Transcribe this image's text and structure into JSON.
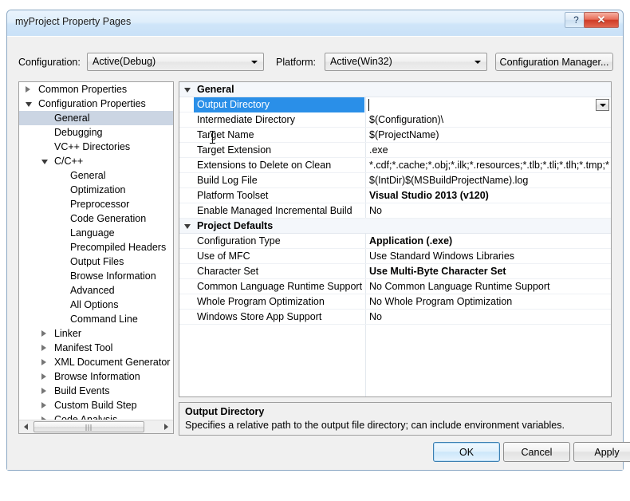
{
  "window": {
    "title": "myProject Property Pages",
    "help_button": "?",
    "close_button": "✕"
  },
  "toolbar": {
    "configuration_label": "Configuration:",
    "configuration_value": "Active(Debug)",
    "platform_label": "Platform:",
    "platform_value": "Active(Win32)",
    "configuration_manager_button": "Configuration Manager..."
  },
  "tree": {
    "items": [
      {
        "label": "Common Properties",
        "indent": 0,
        "twisty": "collapsed",
        "selected": false
      },
      {
        "label": "Configuration Properties",
        "indent": 0,
        "twisty": "expanded",
        "selected": false
      },
      {
        "label": "General",
        "indent": 1,
        "twisty": "none",
        "selected": true
      },
      {
        "label": "Debugging",
        "indent": 1,
        "twisty": "none",
        "selected": false
      },
      {
        "label": "VC++ Directories",
        "indent": 1,
        "twisty": "none",
        "selected": false
      },
      {
        "label": "C/C++",
        "indent": 1,
        "twisty": "expanded",
        "selected": false
      },
      {
        "label": "General",
        "indent": 2,
        "twisty": "none",
        "selected": false
      },
      {
        "label": "Optimization",
        "indent": 2,
        "twisty": "none",
        "selected": false
      },
      {
        "label": "Preprocessor",
        "indent": 2,
        "twisty": "none",
        "selected": false
      },
      {
        "label": "Code Generation",
        "indent": 2,
        "twisty": "none",
        "selected": false
      },
      {
        "label": "Language",
        "indent": 2,
        "twisty": "none",
        "selected": false
      },
      {
        "label": "Precompiled Headers",
        "indent": 2,
        "twisty": "none",
        "selected": false
      },
      {
        "label": "Output Files",
        "indent": 2,
        "twisty": "none",
        "selected": false
      },
      {
        "label": "Browse Information",
        "indent": 2,
        "twisty": "none",
        "selected": false
      },
      {
        "label": "Advanced",
        "indent": 2,
        "twisty": "none",
        "selected": false
      },
      {
        "label": "All Options",
        "indent": 2,
        "twisty": "none",
        "selected": false
      },
      {
        "label": "Command Line",
        "indent": 2,
        "twisty": "none",
        "selected": false
      },
      {
        "label": "Linker",
        "indent": 1,
        "twisty": "collapsed",
        "selected": false
      },
      {
        "label": "Manifest Tool",
        "indent": 1,
        "twisty": "collapsed",
        "selected": false
      },
      {
        "label": "XML Document Generator",
        "indent": 1,
        "twisty": "collapsed",
        "selected": false
      },
      {
        "label": "Browse Information",
        "indent": 1,
        "twisty": "collapsed",
        "selected": false
      },
      {
        "label": "Build Events",
        "indent": 1,
        "twisty": "collapsed",
        "selected": false
      },
      {
        "label": "Custom Build Step",
        "indent": 1,
        "twisty": "collapsed",
        "selected": false
      },
      {
        "label": "Code Analysis",
        "indent": 1,
        "twisty": "collapsed",
        "selected": false
      }
    ]
  },
  "grid": {
    "categories": [
      {
        "name": "General",
        "rows": [
          {
            "label": "Output Directory",
            "value": "",
            "bold": false,
            "editing": true
          },
          {
            "label": "Intermediate Directory",
            "value": "$(Configuration)\\",
            "bold": false,
            "editing": false
          },
          {
            "label": "Target Name",
            "value": "$(ProjectName)",
            "bold": false,
            "editing": false
          },
          {
            "label": "Target Extension",
            "value": ".exe",
            "bold": false,
            "editing": false
          },
          {
            "label": "Extensions to Delete on Clean",
            "value": "*.cdf;*.cache;*.obj;*.ilk;*.resources;*.tlb;*.tli;*.tlh;*.tmp;*.rsp;*",
            "bold": false,
            "editing": false
          },
          {
            "label": "Build Log File",
            "value": "$(IntDir)$(MSBuildProjectName).log",
            "bold": false,
            "editing": false
          },
          {
            "label": "Platform Toolset",
            "value": "Visual Studio 2013 (v120)",
            "bold": true,
            "editing": false
          },
          {
            "label": "Enable Managed Incremental Build",
            "value": "No",
            "bold": false,
            "editing": false
          }
        ]
      },
      {
        "name": "Project Defaults",
        "rows": [
          {
            "label": "Configuration Type",
            "value": "Application (.exe)",
            "bold": true,
            "editing": false
          },
          {
            "label": "Use of MFC",
            "value": "Use Standard Windows Libraries",
            "bold": false,
            "editing": false
          },
          {
            "label": "Character Set",
            "value": "Use Multi-Byte Character Set",
            "bold": true,
            "editing": false
          },
          {
            "label": "Common Language Runtime Support",
            "value": "No Common Language Runtime Support",
            "bold": false,
            "editing": false
          },
          {
            "label": "Whole Program Optimization",
            "value": "No Whole Program Optimization",
            "bold": false,
            "editing": false
          },
          {
            "label": "Windows Store App Support",
            "value": "No",
            "bold": false,
            "editing": false
          }
        ]
      }
    ]
  },
  "description": {
    "title": "Output Directory",
    "text": "Specifies a relative path to the output file directory; can include environment variables."
  },
  "buttons": {
    "ok": "OK",
    "cancel": "Cancel",
    "apply": "Apply"
  },
  "colors": {
    "selection": "#2a8fe8",
    "tree_selection": "#cbd5e3",
    "category_bg": "#f4f7fb",
    "close_button": "#cf3c27"
  }
}
